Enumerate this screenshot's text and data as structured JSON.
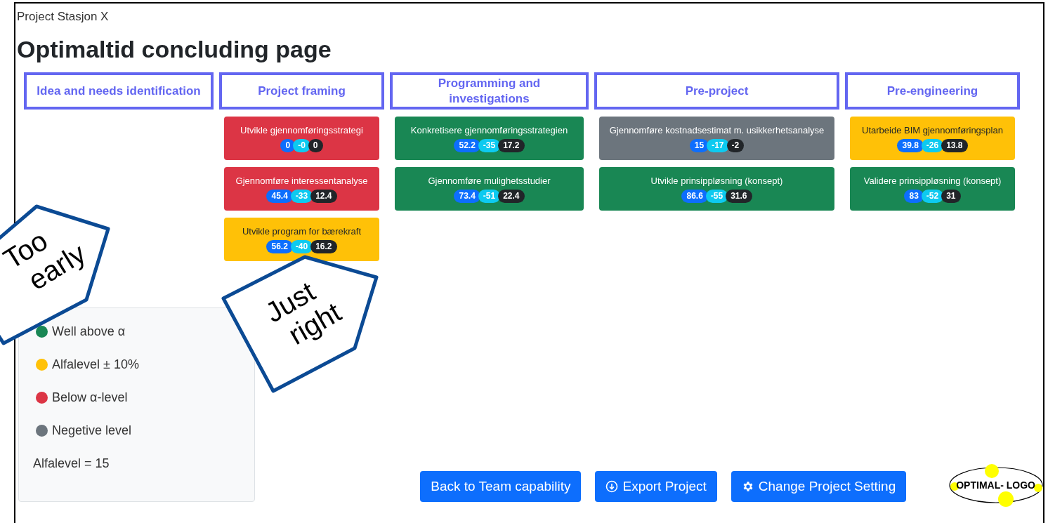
{
  "project": "Project Stasjon X",
  "title": "Optimaltid concluding page",
  "phases": [
    {
      "label": "Idea and needs identification"
    },
    {
      "label": "Project framing",
      "cards": [
        {
          "label": "Utvikle gjennomføringsstrategi",
          "color": "#dc3545",
          "badges": [
            "0",
            "-0",
            "0"
          ]
        },
        {
          "label": "Gjennomføre interessentanalyse",
          "color": "#dc3545",
          "badges": [
            "45.4",
            "-33",
            "12.4"
          ]
        },
        {
          "label": "Utvikle program for bærekraft",
          "color": "#ffc107",
          "badges": [
            "56.2",
            "-40",
            "16.2"
          ]
        }
      ]
    },
    {
      "label": "Programming and investigations",
      "cards": [
        {
          "label": "Konkretisere gjennomføringsstrategien",
          "color": "#198754",
          "badges": [
            "52.2",
            "-35",
            "17.2"
          ]
        },
        {
          "label": "Gjennomføre mulighetsstudier",
          "color": "#198754",
          "badges": [
            "73.4",
            "-51",
            "22.4"
          ]
        }
      ]
    },
    {
      "label": "Pre-project",
      "cards": [
        {
          "label": "Gjennomføre kostnadsestimat m. usikkerhetsanalyse",
          "color": "#6c757d",
          "badges": [
            "15",
            "-17",
            "-2"
          ]
        },
        {
          "label": "Utvikle prinsippløsning (konsept)",
          "color": "#198754",
          "badges": [
            "86.6",
            "-55",
            "31.6"
          ]
        }
      ]
    },
    {
      "label": "Pre-engineering",
      "cards": [
        {
          "label": "Utarbeide BIM gjennomføringsplan",
          "color": "#ffc107",
          "badges": [
            "39.8",
            "-26",
            "13.8"
          ]
        },
        {
          "label": "Validere prinsippløsning (konsept)",
          "color": "#198754",
          "badges": [
            "83",
            "-52",
            "31"
          ]
        }
      ]
    }
  ],
  "legend": {
    "items": [
      {
        "label": "Well above α",
        "color": "#198754"
      },
      {
        "label": "Alfalevel ± 10%",
        "color": "#ffc107"
      },
      {
        "label": "Below α-level",
        "color": "#dc3545"
      },
      {
        "label": "Negetive level",
        "color": "#6c757d"
      }
    ],
    "note": "Alfalevel = 15"
  },
  "buttons": [
    "Back to Team capability",
    "Export Project",
    "Change Project Setting"
  ],
  "logo": "OPTIMAL- LOGO",
  "callouts": [
    {
      "lines": [
        "Too",
        "early"
      ]
    },
    {
      "lines": [
        "Just",
        "right"
      ]
    }
  ]
}
